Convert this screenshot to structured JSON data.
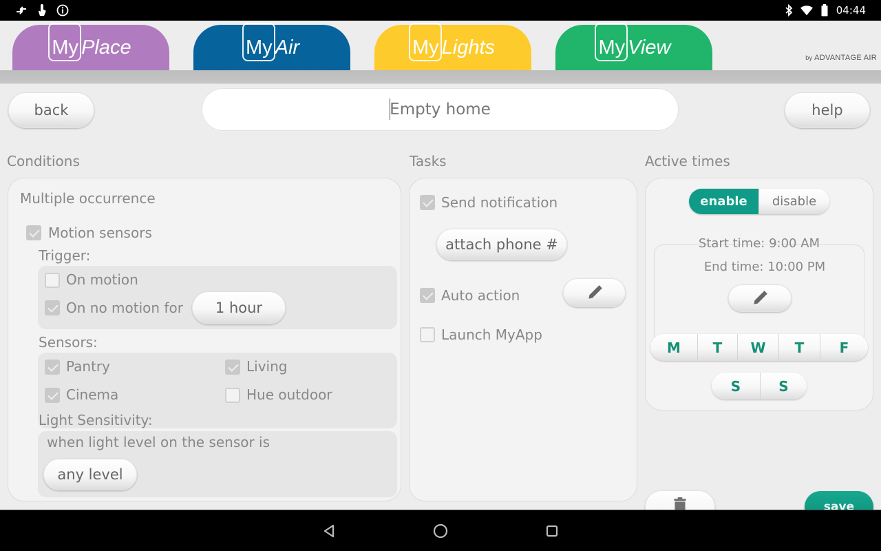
{
  "status_bar": {
    "left_icons": [
      "signal-arrows-icon",
      "touch-hand-icon",
      "info-circle-icon"
    ],
    "right_icons": [
      "bluetooth-icon",
      "wifi-icon",
      "battery-icon"
    ],
    "time": "04:44"
  },
  "brand_tabs": [
    {
      "my": "My",
      "name": "Place",
      "color": "#b07cbf"
    },
    {
      "my": "My",
      "name": "Air",
      "color": "#07639c"
    },
    {
      "my": "My",
      "name": "Lights",
      "color": "#fdcb2b"
    },
    {
      "my": "My",
      "name": "View",
      "color": "#21b46b"
    }
  ],
  "brand_credit": {
    "by": "by",
    "company": "ADVANTAGE AIR"
  },
  "toolbar": {
    "back_label": "back",
    "help_label": "help",
    "scene_name_value": "Empty home"
  },
  "conditions": {
    "title": "Conditions",
    "occurrence": "Multiple occurrence",
    "motion_sensors": {
      "label": "Motion sensors",
      "checked": true
    },
    "trigger_label": "Trigger:",
    "triggers": [
      {
        "label": "On motion",
        "checked": false
      },
      {
        "label": "On no motion for",
        "checked": true,
        "duration": "1 hour"
      }
    ],
    "sensors_label": "Sensors:",
    "sensors": [
      {
        "label": "Pantry",
        "checked": true
      },
      {
        "label": "Living",
        "checked": true
      },
      {
        "label": "Cinema",
        "checked": true
      },
      {
        "label": "Hue outdoor",
        "checked": false
      }
    ],
    "light_sensitivity_label": "Light Sensitivity:",
    "light_condition_text": "when light level on the sensor is",
    "light_level": "any level"
  },
  "tasks": {
    "title": "Tasks",
    "send_notification": {
      "label": "Send notification",
      "checked": true
    },
    "attach_phone_label": "attach phone #",
    "auto_action": {
      "label": "Auto action",
      "checked": true
    },
    "launch_myapp": {
      "label": "Launch MyApp",
      "checked": false
    }
  },
  "active_times": {
    "title": "Active times",
    "toggle": {
      "enable": "enable",
      "disable": "disable",
      "selected": "enable"
    },
    "start_time": "Start time: 9:00 AM",
    "end_time": "End time: 10:00 PM",
    "weekdays": [
      "M",
      "T",
      "W",
      "T",
      "F"
    ],
    "weekend": [
      "S",
      "S"
    ]
  },
  "footer": {
    "save_label": "save"
  },
  "colors": {
    "accent": "#0f9b87",
    "background": "#ededed",
    "text": "#888888"
  }
}
